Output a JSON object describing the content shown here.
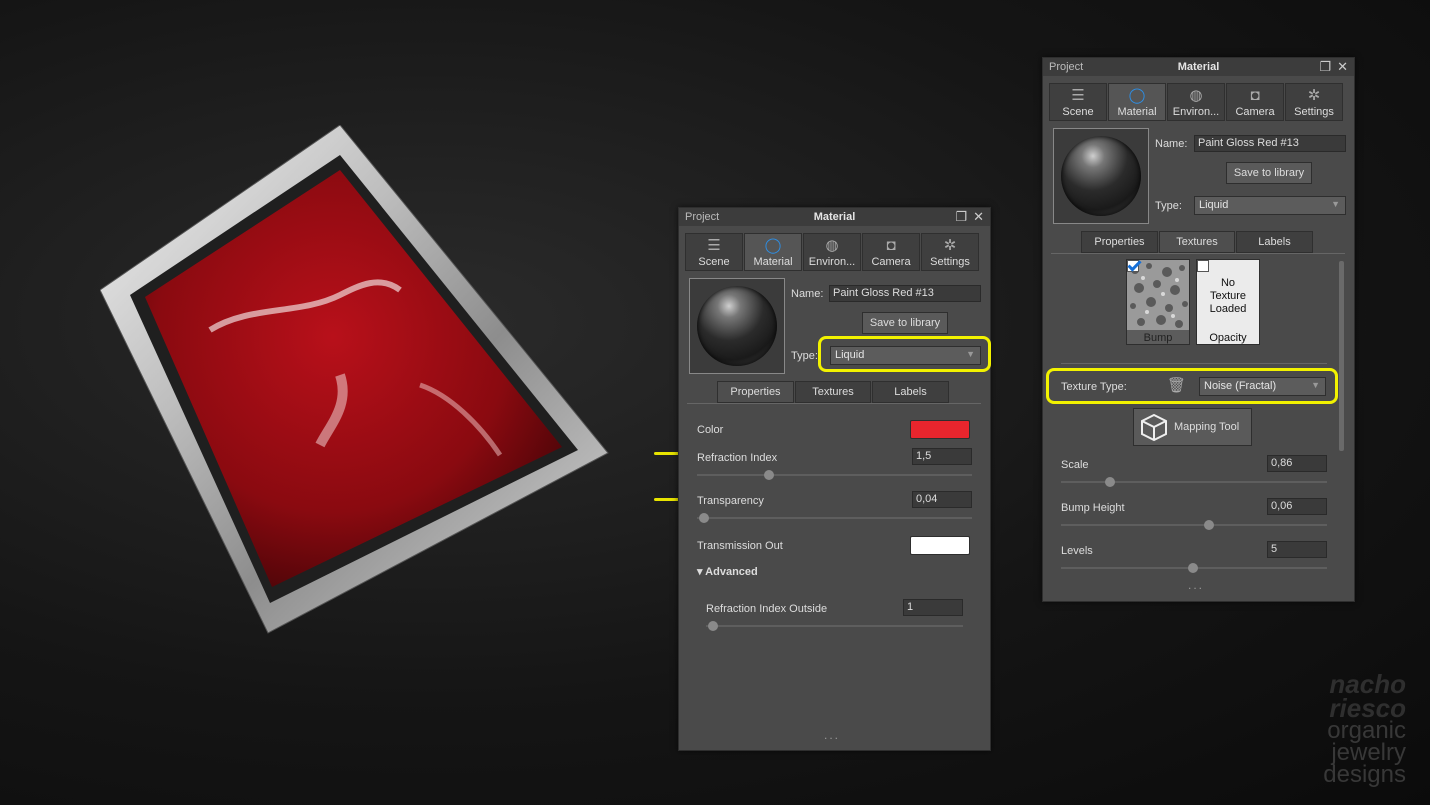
{
  "left_panel": {
    "project_label": "Project",
    "title": "Material",
    "tabs": [
      {
        "label": "Scene",
        "icon": "scene-icon"
      },
      {
        "label": "Material",
        "icon": "material-icon"
      },
      {
        "label": "Environ...",
        "icon": "environment-icon"
      },
      {
        "label": "Camera",
        "icon": "camera-icon"
      },
      {
        "label": "Settings",
        "icon": "settings-icon"
      }
    ],
    "name_label": "Name:",
    "name_value": "Paint Gloss Red #13",
    "save_label": "Save to library",
    "type_label": "Type:",
    "type_value": "Liquid",
    "subtabs": [
      "Properties",
      "Textures",
      "Labels"
    ],
    "props": {
      "color_label": "Color",
      "color_value": "#e8252d",
      "refraction_label": "Refraction Index",
      "refraction_value": "1,5",
      "transparency_label": "Transparency",
      "transparency_value": "0,04",
      "transmission_label": "Transmission Out",
      "transmission_value": "#ffffff",
      "advanced_label": "Advanced",
      "refraction_outside_label": "Refraction Index Outside",
      "refraction_outside_value": "1"
    },
    "dots": "..."
  },
  "right_panel": {
    "project_label": "Project",
    "title": "Material",
    "tabs": [
      {
        "label": "Scene",
        "icon": "scene-icon"
      },
      {
        "label": "Material",
        "icon": "material-icon"
      },
      {
        "label": "Environ...",
        "icon": "environment-icon"
      },
      {
        "label": "Camera",
        "icon": "camera-icon"
      },
      {
        "label": "Settings",
        "icon": "settings-icon"
      }
    ],
    "name_label": "Name:",
    "name_value": "Paint Gloss Red #13",
    "save_label": "Save to library",
    "type_label": "Type:",
    "type_value": "Liquid",
    "subtabs": [
      "Properties",
      "Textures",
      "Labels"
    ],
    "textures": {
      "bump_label": "Bump",
      "opacity_empty": "No Texture Loaded",
      "opacity_label": "Opacity",
      "texture_type_label": "Texture Type:",
      "texture_type_value": "Noise (Fractal)",
      "mapping_tool_label": "Mapping Tool",
      "scale_label": "Scale",
      "scale_value": "0,86",
      "bump_height_label": "Bump Height",
      "bump_height_value": "0,06",
      "levels_label": "Levels",
      "levels_value": "5"
    },
    "dots": "..."
  },
  "watermark": {
    "line1": "nacho",
    "line2": "riesco",
    "line3": "organic",
    "line4": "jewelry",
    "line5": "designs"
  }
}
